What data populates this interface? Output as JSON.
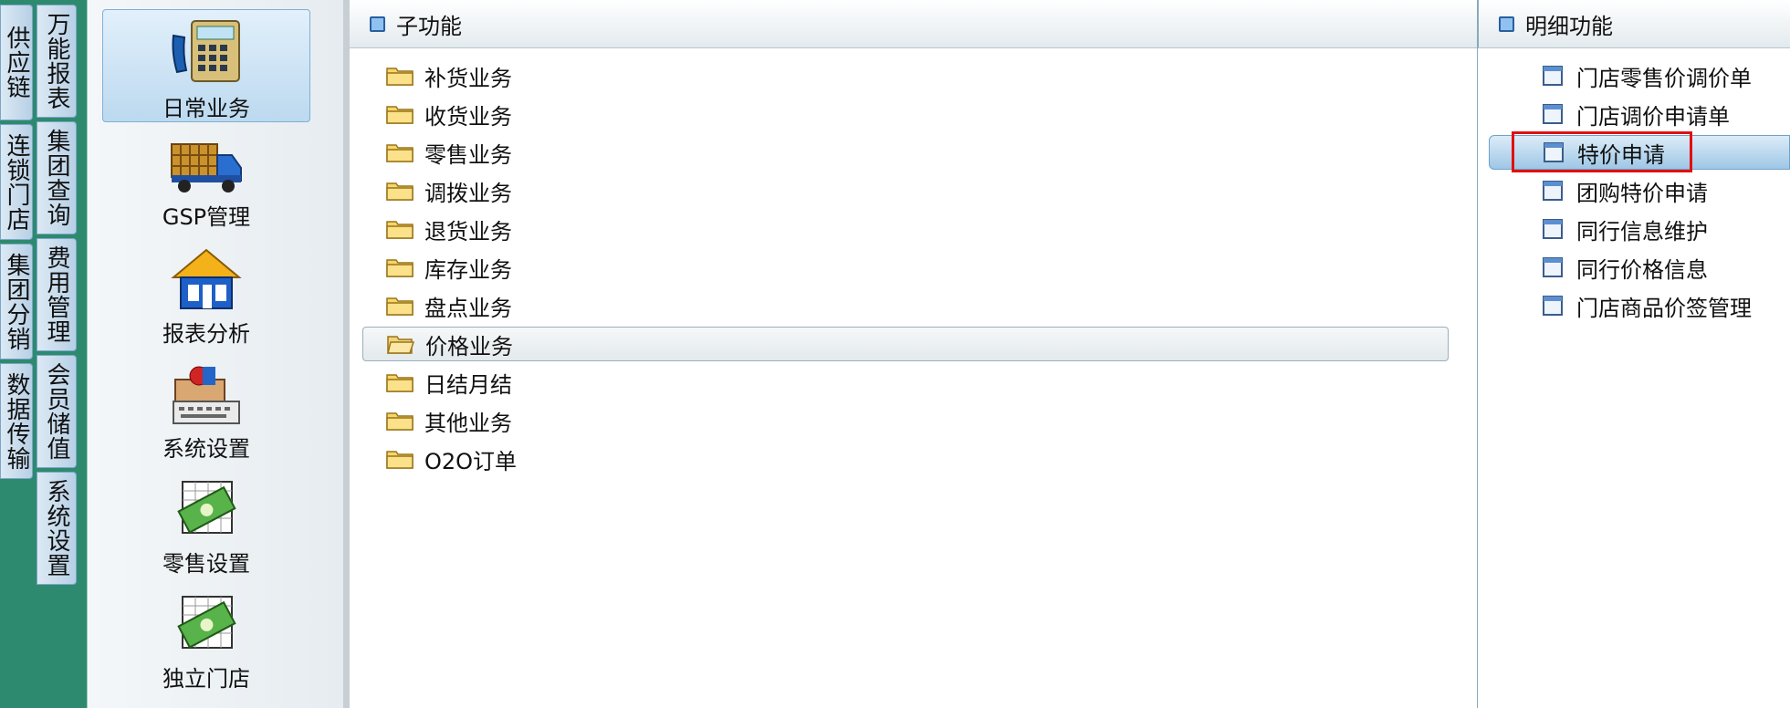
{
  "outer_tabs": [
    "供应链",
    "连锁门店",
    "集团分销",
    "数据传输"
  ],
  "inner_tabs": [
    "万能报表",
    "集团查询",
    "费用管理",
    "会员储值",
    "系统设置"
  ],
  "modules": [
    {
      "label": "日常业务",
      "icon": "telephone-calculator-icon",
      "selected": true
    },
    {
      "label": "GSP管理",
      "icon": "delivery-truck-icon",
      "selected": false
    },
    {
      "label": "报表分析",
      "icon": "house-icon",
      "selected": false
    },
    {
      "label": "系统设置",
      "icon": "computer-keyboard-icon",
      "selected": false
    },
    {
      "label": "零售设置",
      "icon": "money-icon",
      "selected": false
    },
    {
      "label": "独立门店",
      "icon": "money-icon",
      "selected": false
    }
  ],
  "sub_functions": {
    "header": "子功能",
    "items": [
      "补货业务",
      "收货业务",
      "零售业务",
      "调拨业务",
      "退货业务",
      "库存业务",
      "盘点业务",
      "价格业务",
      "日结月结",
      "其他业务",
      "O2O订单"
    ],
    "selected": "价格业务"
  },
  "detail_functions": {
    "header": "明细功能",
    "items": [
      "门店零售价调价单",
      "门店调价申请单",
      "特价申请",
      "团购特价申请",
      "同行信息维护",
      "同行价格信息",
      "门店商品价签管理"
    ],
    "selected": "特价申请",
    "highlighted": "特价申请"
  },
  "colors": {
    "background": "#2e8a6e",
    "highlight": "#e01010",
    "selection": "#9ec7e6"
  }
}
